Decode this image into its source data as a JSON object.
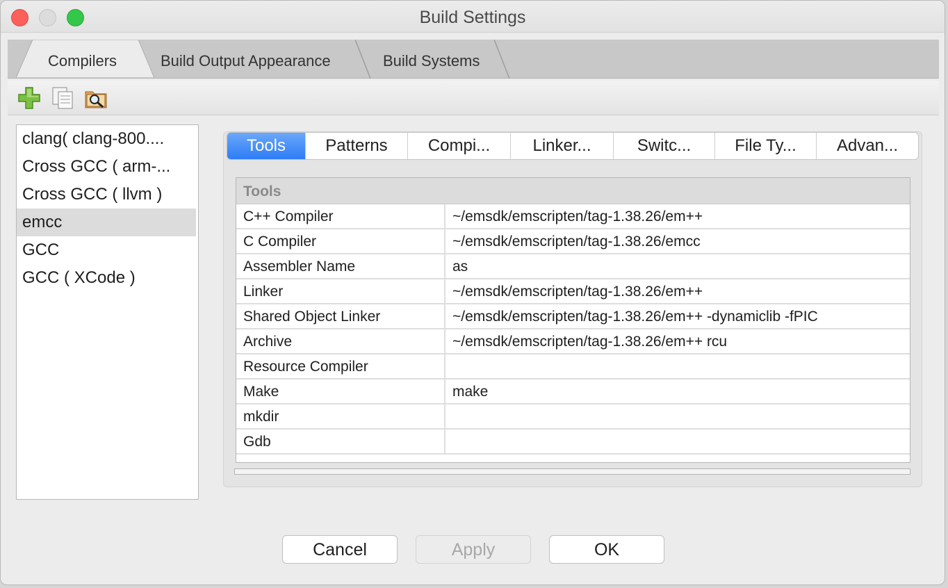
{
  "window": {
    "title": "Build Settings"
  },
  "top_tabs": [
    {
      "label": "Compilers",
      "active": true
    },
    {
      "label": "Build Output Appearance",
      "active": false
    },
    {
      "label": "Build Systems",
      "active": false
    }
  ],
  "toolbar": {
    "icons": [
      "add-icon",
      "copy-icon",
      "find-icon"
    ]
  },
  "compilers": [
    {
      "label": "clang( clang-800....",
      "selected": false
    },
    {
      "label": "Cross GCC ( arm-...",
      "selected": false
    },
    {
      "label": "Cross GCC ( llvm )",
      "selected": false
    },
    {
      "label": "emcc",
      "selected": true
    },
    {
      "label": "GCC",
      "selected": false
    },
    {
      "label": "GCC ( XCode )",
      "selected": false
    }
  ],
  "subtabs": [
    {
      "label": "Tools",
      "active": true
    },
    {
      "label": "Patterns",
      "active": false
    },
    {
      "label": "Compi...",
      "active": false
    },
    {
      "label": "Linker...",
      "active": false
    },
    {
      "label": "Switc...",
      "active": false
    },
    {
      "label": "File Ty...",
      "active": false
    },
    {
      "label": "Advan...",
      "active": false
    }
  ],
  "tools": {
    "header": "Tools",
    "rows": [
      {
        "name": "C++ Compiler",
        "value": "~/emsdk/emscripten/tag-1.38.26/em++"
      },
      {
        "name": "C Compiler",
        "value": "~/emsdk/emscripten/tag-1.38.26/emcc"
      },
      {
        "name": "Assembler Name",
        "value": "as"
      },
      {
        "name": "Linker",
        "value": "~/emsdk/emscripten/tag-1.38.26/em++"
      },
      {
        "name": "Shared Object Linker",
        "value": "~/emsdk/emscripten/tag-1.38.26/em++ -dynamiclib -fPIC"
      },
      {
        "name": "Archive",
        "value": "~/emsdk/emscripten/tag-1.38.26/em++ rcu"
      },
      {
        "name": "Resource Compiler",
        "value": ""
      },
      {
        "name": "Make",
        "value": "make"
      },
      {
        "name": "mkdir",
        "value": ""
      },
      {
        "name": "Gdb",
        "value": ""
      }
    ]
  },
  "buttons": {
    "cancel": "Cancel",
    "apply": "Apply",
    "ok": "OK"
  },
  "colors": {
    "accent": "#2e7cf6",
    "close": "#fc605b",
    "maximize": "#34c84a"
  }
}
